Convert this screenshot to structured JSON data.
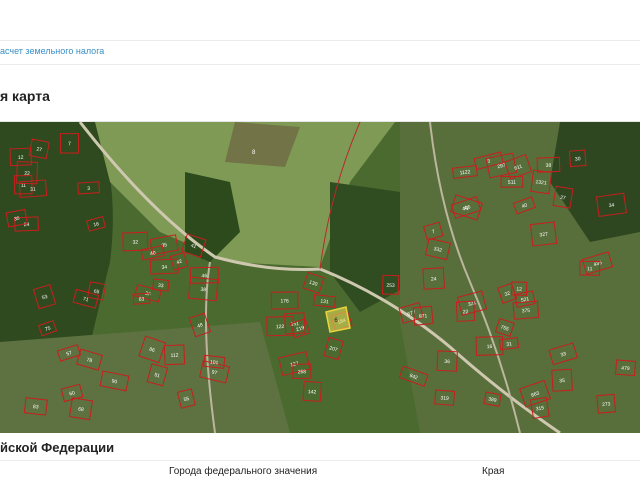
{
  "breadcrumb": {
    "link_text": "асчет земельного налога"
  },
  "map_section": {
    "title": "я карта"
  },
  "map": {
    "imagery": "satellite",
    "parcel_border_color": "#c81e1e",
    "selected_parcel_color": "#f2e25a",
    "selected_parcel_label": "6",
    "field_label": "8",
    "parcel_labels": [
      "12",
      "3",
      "7",
      "11",
      "16",
      "22",
      "24",
      "27",
      "30",
      "31",
      "32",
      "33",
      "34",
      "35",
      "36",
      "38",
      "40",
      "41",
      "42",
      "46",
      "48",
      "51",
      "53",
      "55",
      "57",
      "60",
      "63",
      "65",
      "68",
      "71",
      "75",
      "78",
      "83",
      "86",
      "90",
      "97",
      "101",
      "112",
      "122",
      "127",
      "130",
      "131",
      "142",
      "151",
      "176",
      "184",
      "207",
      "219",
      "253",
      "268",
      "273",
      "297",
      "315",
      "319",
      "321",
      "327",
      "332",
      "375",
      "389",
      "436",
      "446",
      "479",
      "511",
      "521",
      "611",
      "677",
      "755",
      "842",
      "863",
      "871",
      "1321",
      "1122"
    ]
  },
  "federation_section": {
    "title": "йской Федерации",
    "columns": [
      "Города федерального значения",
      "Края"
    ]
  }
}
